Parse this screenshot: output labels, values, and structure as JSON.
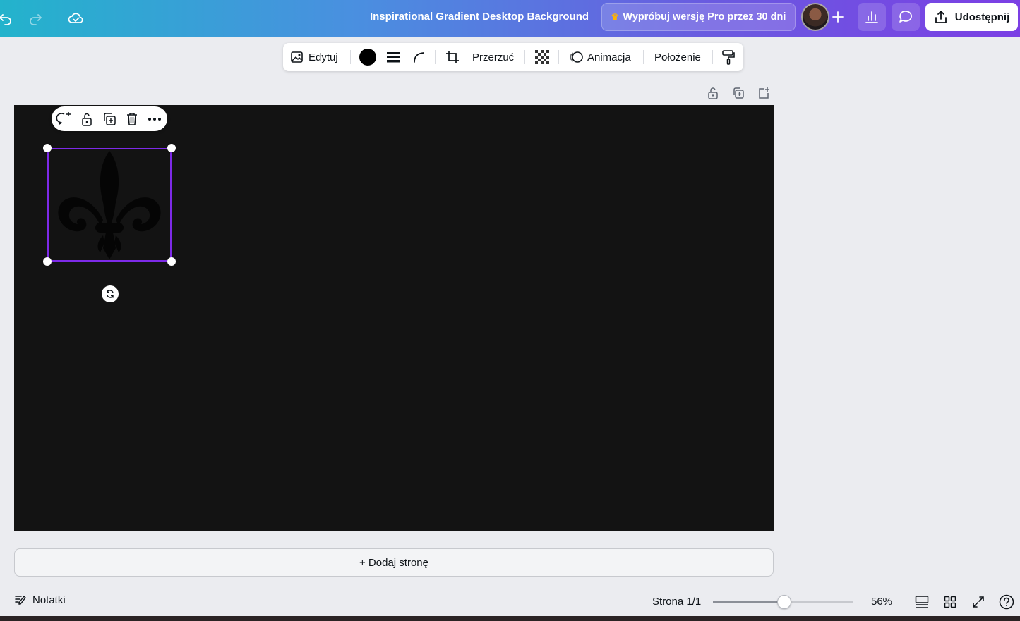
{
  "topbar": {
    "title": "Inspirational Gradient Desktop Background",
    "pro_label": "Wypróbuj wersję Pro przez 30 dni",
    "share_label": "Udostępnij",
    "icons": [
      "undo-icon",
      "redo-icon",
      "cloud-saved-icon",
      "crown-icon",
      "plus-icon",
      "chart-icon",
      "comment-icon",
      "share-icon"
    ]
  },
  "context_toolbar": {
    "edit_label": "Edytuj",
    "flip_label": "Przerzuć",
    "animate_label": "Animacja",
    "position_label": "Położenie",
    "color": "#000000"
  },
  "canvas": {
    "background": "#131313",
    "selection_color": "#7d2ae8"
  },
  "add_page_label": "+ Dodaj stronę",
  "footer": {
    "notes_label": "Notatki",
    "page_indicator": "Strona 1/1",
    "zoom_label": "56%",
    "zoom_value": 56
  }
}
